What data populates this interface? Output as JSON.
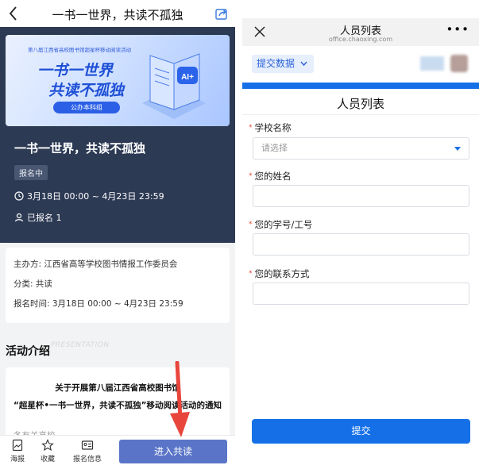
{
  "left": {
    "top_bar": {
      "title": "一书一世界，共读不孤独",
      "back_icon": "chevron-left-icon",
      "share_icon": "share-icon"
    },
    "banner": {
      "small_text": "第八届江西省高校图书馆超星杯移动阅读活动",
      "title_line1": "一书一世界",
      "title_line2": "共读不孤独",
      "group_pill": "公办本科组",
      "badge_text": "AI+"
    },
    "event": {
      "title": "一书一世界，共读不孤独",
      "status_badge": "报名中",
      "time": "3月18日 00:00 ~ 4月23日 23:59",
      "signup_count": "已报名 1"
    },
    "info": {
      "organizer": "主办方: 江西省高等学校图书情报工作委员会",
      "category": "分类: 共读",
      "signup_time": "报名时间: 3月18日 00:00 ~ 4月23日 23:59"
    },
    "section": {
      "title": "活动介绍",
      "subtitle_en": "PRESENTATION"
    },
    "notice": {
      "line1": "关于开展第八届江西省高校图书馆",
      "line2": "“超星杯•一书一世界，共读不孤独”移动阅读活动的通知",
      "line3": "各有关高校..."
    },
    "bottom_bar": {
      "items": [
        {
          "label": "海报",
          "icon": "poster-icon"
        },
        {
          "label": "收藏",
          "icon": "star-icon"
        },
        {
          "label": "报名信息",
          "icon": "signup-info-icon"
        }
      ],
      "join_button": "进入共读"
    },
    "colors": {
      "hero_bg": "#2d3a54",
      "join_button": "#5a75c8",
      "arrow": "#e8463c"
    }
  },
  "right": {
    "header": {
      "title": "人员列表",
      "url": "office.chaoxing.com",
      "close_icon": "close-icon",
      "more_icon": "more-icon"
    },
    "submit_data_button": "提交数据",
    "form_title": "人员列表",
    "fields": [
      {
        "label": "学校名称",
        "required": true,
        "type": "select",
        "placeholder": "请选择",
        "value": ""
      },
      {
        "label": "您的姓名",
        "required": true,
        "type": "text",
        "placeholder": "",
        "value": ""
      },
      {
        "label": "您的学号/工号",
        "required": true,
        "type": "text",
        "placeholder": "",
        "value": ""
      },
      {
        "label": "您的联系方式",
        "required": true,
        "type": "text",
        "placeholder": "",
        "value": ""
      }
    ],
    "required_mark": "*",
    "submit_button": "提交",
    "colors": {
      "accent": "#1570e8",
      "required": "#e74c3c"
    }
  }
}
